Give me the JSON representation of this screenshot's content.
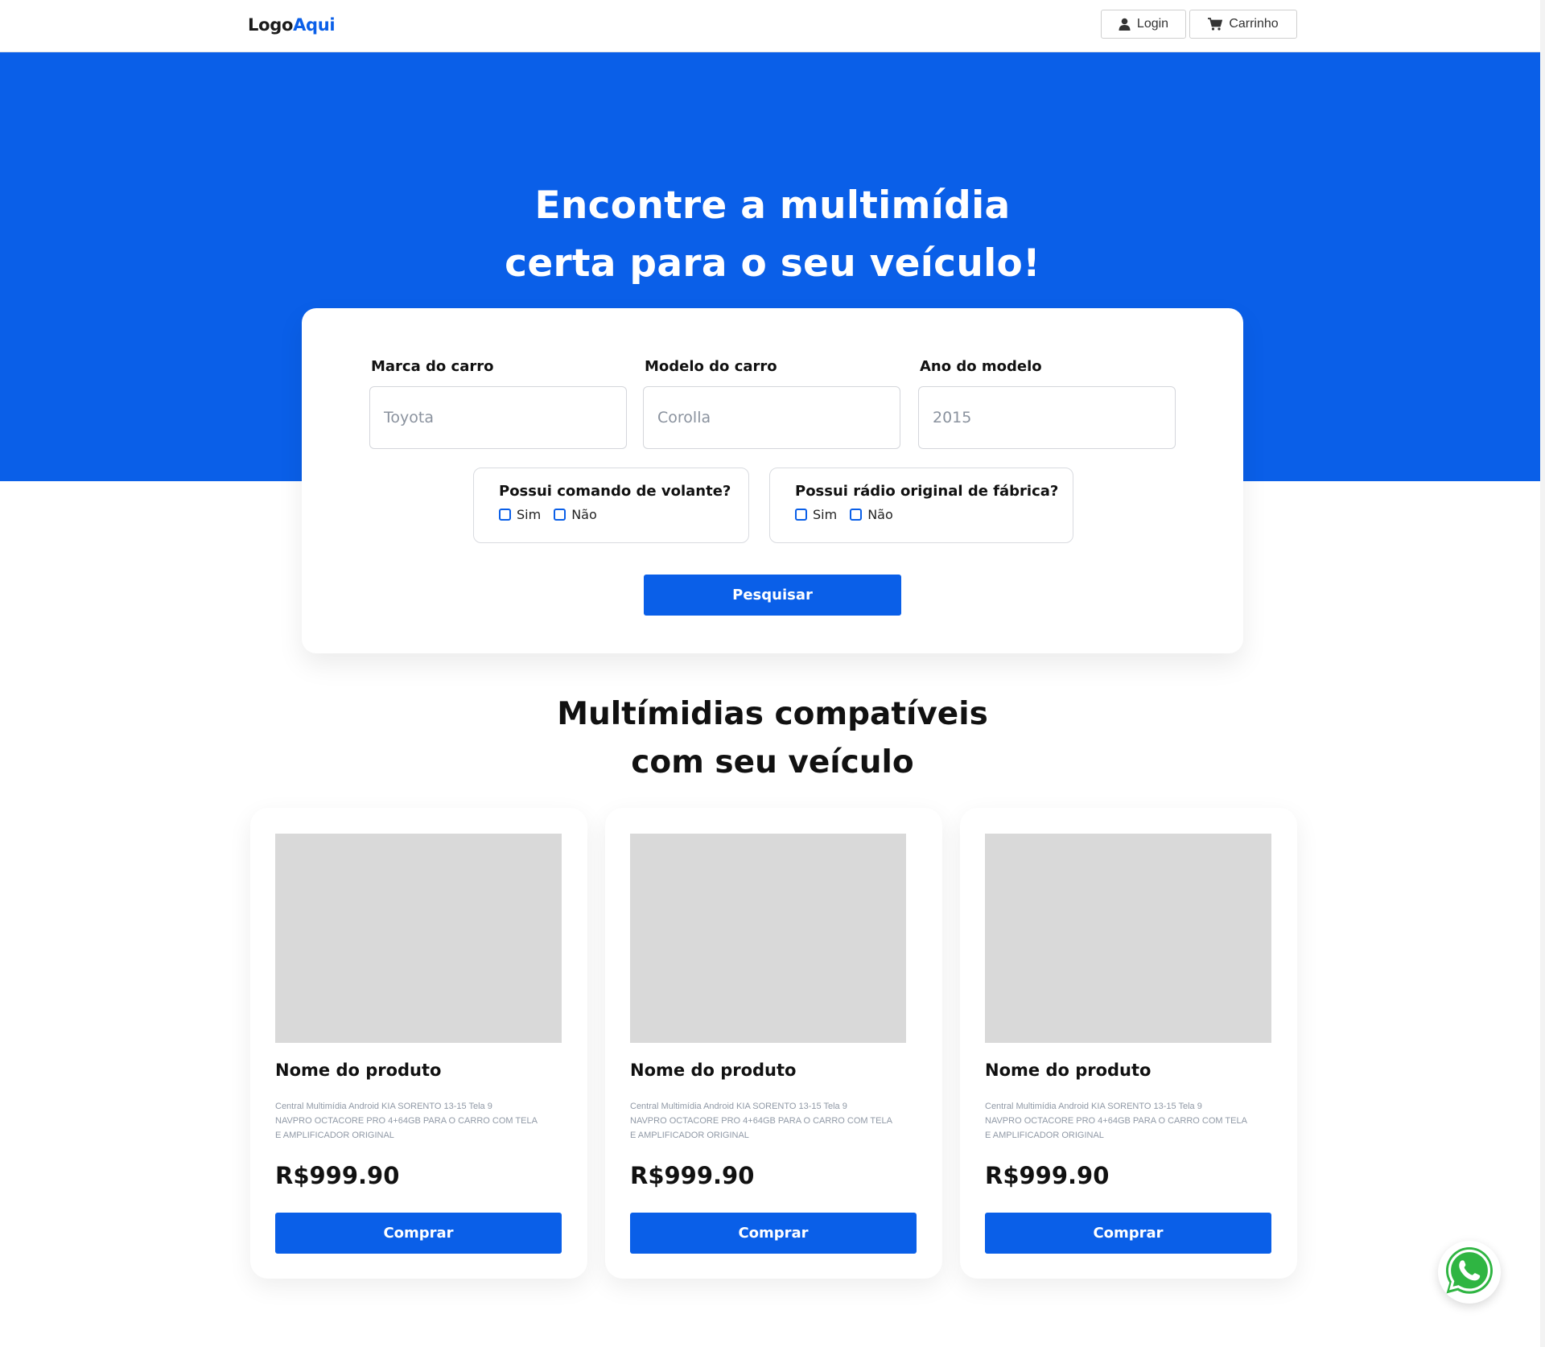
{
  "header": {
    "logo_part1": "Logo",
    "logo_part2": "Aqui",
    "login_label": "Login",
    "cart_label": "Carrinho",
    "login_icon": "user-icon",
    "cart_icon": "cart-icon"
  },
  "hero": {
    "title_line1": "Encontre a multimídia",
    "title_line2": "certa para o seu veículo!"
  },
  "search": {
    "brand_label": "Marca do carro",
    "brand_placeholder": "Toyota",
    "model_label": "Modelo do carro",
    "model_placeholder": "Corolla",
    "year_label": "Ano do modelo",
    "year_placeholder": "2015",
    "q1": {
      "title": "Possui comando de volante?",
      "yes": "Sim",
      "no": "Não"
    },
    "q2": {
      "title": "Possui rádio original de fábrica?",
      "yes": "Sim",
      "no": "Não"
    },
    "button_label": "Pesquisar"
  },
  "results": {
    "title_line1": "Multímidias compatíveis",
    "title_line2": "com seu veículo"
  },
  "products": [
    {
      "name": "Nome do produto",
      "desc_line1": "Central Multimídia Android KIA SORENTO 13-15 Tela 9",
      "desc_line2": "NAVPRO OCTACORE PRO 4+64GB PARA O CARRO COM TELA",
      "desc_line3": "E AMPLIFICADOR ORIGINAL",
      "price": "R$999.90",
      "button": "Comprar"
    },
    {
      "name": "Nome do produto",
      "desc_line1": "Central Multimídia Android KIA SORENTO 13-15 Tela 9",
      "desc_line2": "NAVPRO OCTACORE PRO 4+64GB PARA O CARRO COM TELA",
      "desc_line3": "E AMPLIFICADOR ORIGINAL",
      "price": "R$999.90",
      "button": "Comprar"
    },
    {
      "name": "Nome do produto",
      "desc_line1": "Central Multimídia Android KIA SORENTO 13-15 Tela 9",
      "desc_line2": "NAVPRO OCTACORE PRO 4+64GB PARA O CARRO COM TELA",
      "desc_line3": "E AMPLIFICADOR ORIGINAL",
      "price": "R$999.90",
      "button": "Comprar"
    }
  ],
  "floating": {
    "icon": "whatsapp-icon"
  },
  "colors": {
    "brand_blue": "#0a5fe8",
    "whatsapp_green": "#2fb542",
    "placeholder_gray": "#d9d9d9"
  }
}
